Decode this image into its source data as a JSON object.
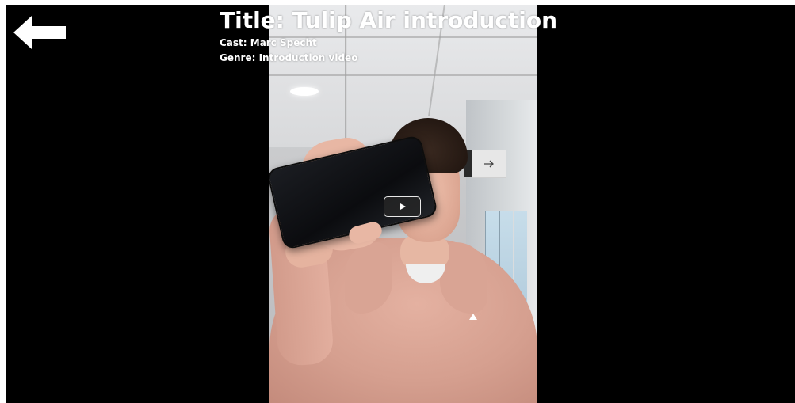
{
  "video": {
    "title": "Title: Tulip Air introduction",
    "cast": "Cast: Marc Specht",
    "genre": "Genre: Introduction video"
  },
  "controls": {
    "back_icon": "arrow-left-icon",
    "play_icon": "play-icon"
  },
  "colors": {
    "background": "#000000",
    "text": "#ffffff",
    "play_button_bg": "#282828"
  }
}
